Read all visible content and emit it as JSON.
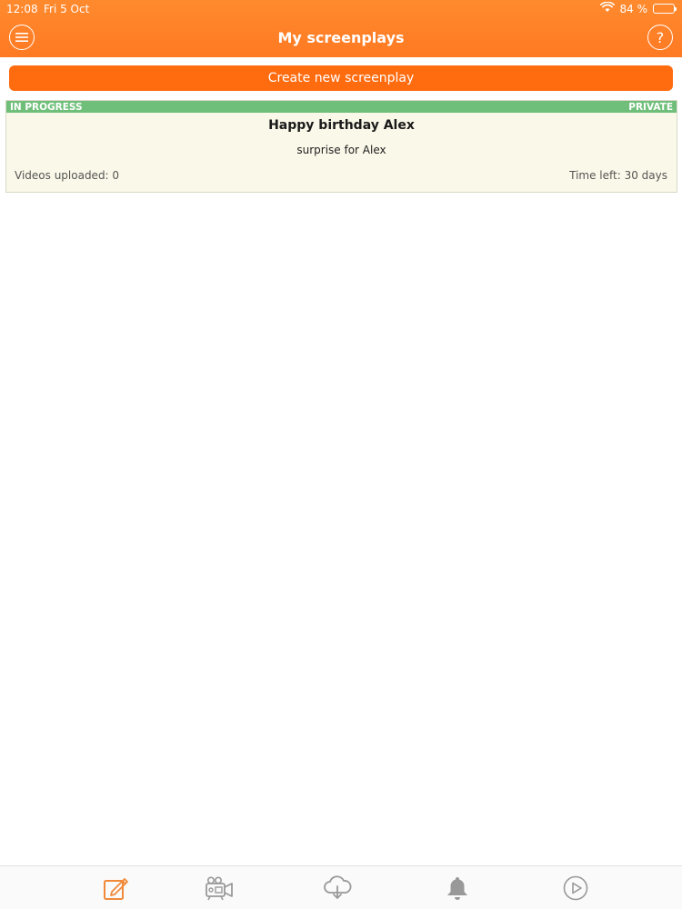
{
  "status_bar": {
    "time": "12:08",
    "date": "Fri 5 Oct",
    "battery_percent": "84 %",
    "battery_level": 0.84
  },
  "nav": {
    "title": "My screenplays",
    "menu_icon": "hamburger-menu-icon",
    "help_label": "?"
  },
  "actions": {
    "create_label": "Create new screenplay"
  },
  "screenplays": [
    {
      "status": "IN PROGRESS",
      "visibility": "PRIVATE",
      "title": "Happy birthday Alex",
      "description": "surprise for Alex",
      "videos_uploaded": "Videos uploaded: 0",
      "time_left": "Time left: 30 days"
    }
  ],
  "tabs": [
    {
      "icon": "edit-icon",
      "active": true
    },
    {
      "icon": "video-camera-icon",
      "active": false
    },
    {
      "icon": "cloud-download-icon",
      "active": false
    },
    {
      "icon": "bell-icon",
      "active": false
    },
    {
      "icon": "play-circle-icon",
      "active": false
    }
  ],
  "colors": {
    "brand_orange": "#ff7a22",
    "button_orange": "#ff6b0f",
    "status_green": "#6fbf7a",
    "card_bg": "#faf8e8",
    "tab_active": "#f08a3a",
    "tab_inactive": "#999999"
  }
}
